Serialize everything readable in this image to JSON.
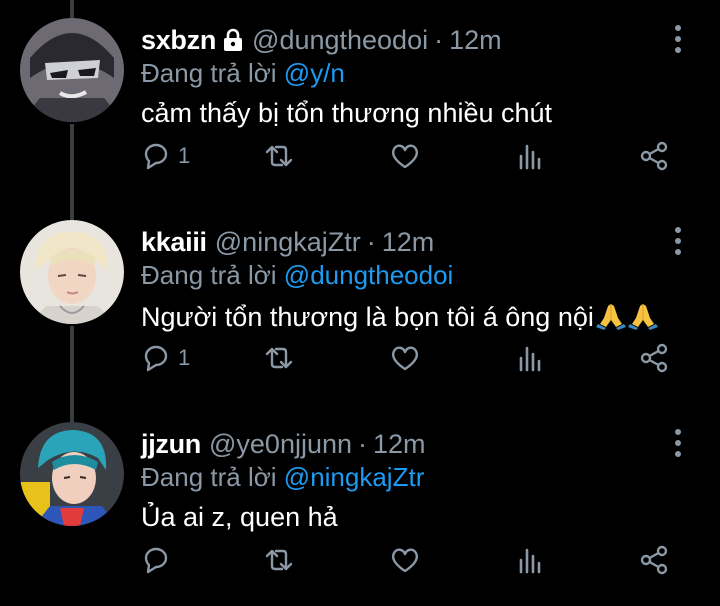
{
  "colors": {
    "background": "#000000",
    "text": "#ffffff",
    "secondary": "#8b98a5",
    "mention": "#1d9bf0",
    "thread_line": "#3a3d40"
  },
  "tweets": [
    {
      "name": "sxbzn",
      "locked": true,
      "handle": "@dungtheodoi",
      "separator": "·",
      "time": "12m",
      "replying_prefix": "Đang trả lời",
      "replying_to": "@y/n",
      "text": "cảm thấy bị tổn thương nhiều chút",
      "emoji": [],
      "reply_count": "1",
      "icons": [
        "reply-icon",
        "retweet-icon",
        "like-icon",
        "analytics-icon",
        "share-icon",
        "more-icon"
      ]
    },
    {
      "name": "kkaiii",
      "locked": false,
      "handle": "@ningkajZtr",
      "separator": "·",
      "time": "12m",
      "replying_prefix": "Đang trả lời",
      "replying_to": "@dungtheodoi",
      "text": "Người tổn thương là bọn tôi á ông nội",
      "emoji": [
        "folded-hands",
        "folded-hands"
      ],
      "reply_count": "1",
      "icons": [
        "reply-icon",
        "retweet-icon",
        "like-icon",
        "analytics-icon",
        "share-icon",
        "more-icon"
      ]
    },
    {
      "name": "jjzun",
      "locked": false,
      "handle": "@ye0njjunn",
      "separator": "·",
      "time": "12m",
      "replying_prefix": "Đang trả lời",
      "replying_to": "@ningkajZtr",
      "text": "Ủa ai z, quen hả",
      "emoji": [],
      "reply_count": "",
      "icons": [
        "reply-icon",
        "retweet-icon",
        "like-icon",
        "analytics-icon",
        "share-icon",
        "more-icon"
      ]
    }
  ]
}
